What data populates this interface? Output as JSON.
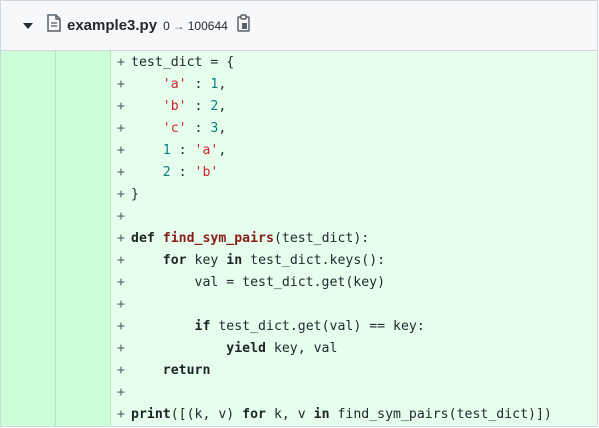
{
  "file": {
    "name": "example3.py",
    "mode_old": "0",
    "mode_arrow": "→",
    "mode_new": "100644"
  },
  "diff": {
    "marker": "+",
    "lines": [
      [
        {
          "t": "test_dict = {",
          "c": ""
        }
      ],
      [
        {
          "t": "    ",
          "c": ""
        },
        {
          "t": "'a'",
          "c": "str"
        },
        {
          "t": " : ",
          "c": ""
        },
        {
          "t": "1",
          "c": "num"
        },
        {
          "t": ",",
          "c": ""
        }
      ],
      [
        {
          "t": "    ",
          "c": ""
        },
        {
          "t": "'b'",
          "c": "str"
        },
        {
          "t": " : ",
          "c": ""
        },
        {
          "t": "2",
          "c": "num"
        },
        {
          "t": ",",
          "c": ""
        }
      ],
      [
        {
          "t": "    ",
          "c": ""
        },
        {
          "t": "'c'",
          "c": "str"
        },
        {
          "t": " : ",
          "c": ""
        },
        {
          "t": "3",
          "c": "num"
        },
        {
          "t": ",",
          "c": ""
        }
      ],
      [
        {
          "t": "    ",
          "c": ""
        },
        {
          "t": "1",
          "c": "num"
        },
        {
          "t": " : ",
          "c": ""
        },
        {
          "t": "'a'",
          "c": "str"
        },
        {
          "t": ",",
          "c": ""
        }
      ],
      [
        {
          "t": "    ",
          "c": ""
        },
        {
          "t": "2",
          "c": "num"
        },
        {
          "t": " : ",
          "c": ""
        },
        {
          "t": "'b'",
          "c": "str"
        }
      ],
      [
        {
          "t": "}",
          "c": ""
        }
      ],
      [],
      [
        {
          "t": "def",
          "c": "kw"
        },
        {
          "t": " ",
          "c": ""
        },
        {
          "t": "find_sym_pairs",
          "c": "fn"
        },
        {
          "t": "(test_dict):",
          "c": ""
        }
      ],
      [
        {
          "t": "    ",
          "c": ""
        },
        {
          "t": "for",
          "c": "kw"
        },
        {
          "t": " key ",
          "c": ""
        },
        {
          "t": "in",
          "c": "kw"
        },
        {
          "t": " test_dict.keys():",
          "c": ""
        }
      ],
      [
        {
          "t": "        val = test_dict.get(key)",
          "c": ""
        }
      ],
      [],
      [
        {
          "t": "        ",
          "c": ""
        },
        {
          "t": "if",
          "c": "kw"
        },
        {
          "t": " test_dict.get(val) == key:",
          "c": ""
        }
      ],
      [
        {
          "t": "            ",
          "c": ""
        },
        {
          "t": "yield",
          "c": "kw"
        },
        {
          "t": " key, val",
          "c": ""
        }
      ],
      [
        {
          "t": "    ",
          "c": ""
        },
        {
          "t": "return",
          "c": "kw"
        }
      ],
      [],
      [
        {
          "t": "print",
          "c": "kw"
        },
        {
          "t": "([(k, v) ",
          "c": ""
        },
        {
          "t": "for",
          "c": "kw"
        },
        {
          "t": " k, v ",
          "c": ""
        },
        {
          "t": "in",
          "c": "kw"
        },
        {
          "t": " find_sym_pairs(test_dict)])",
          "c": ""
        }
      ]
    ]
  }
}
